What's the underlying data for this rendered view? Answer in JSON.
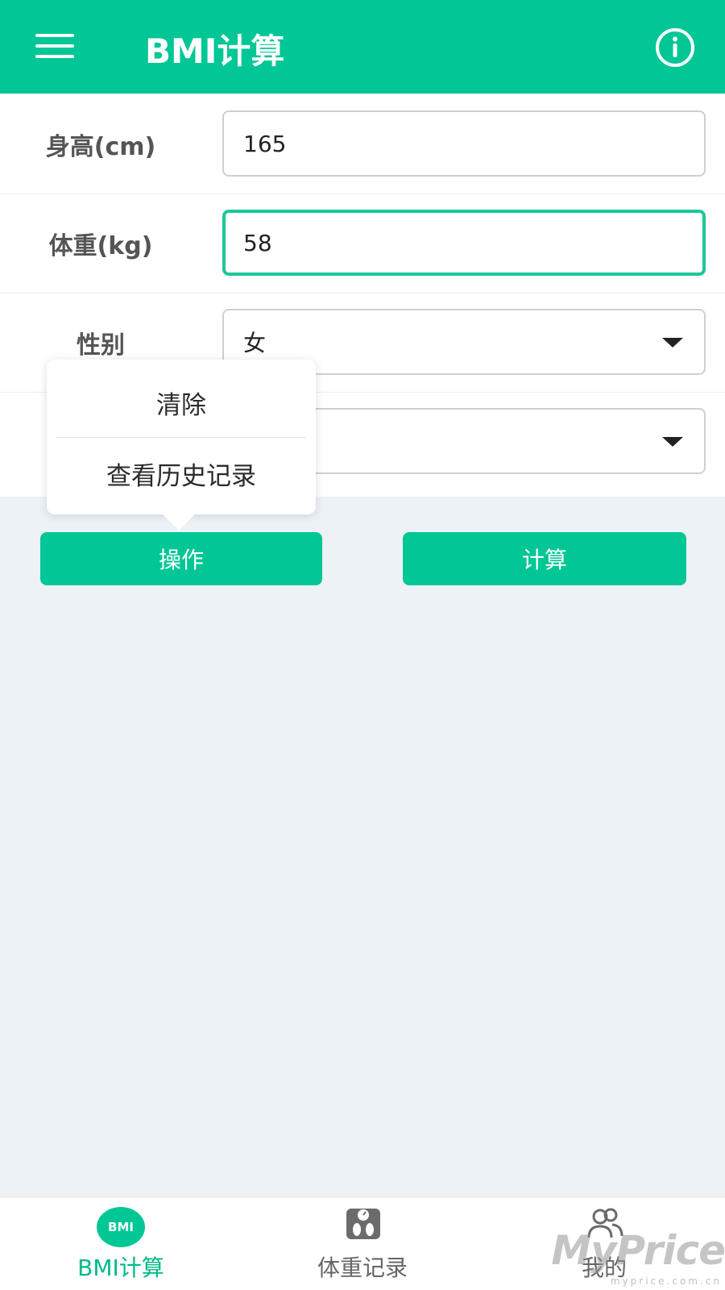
{
  "header": {
    "title": "BMI计算",
    "menu_icon": "hamburger-menu-icon",
    "info_icon": "info-icon"
  },
  "form": {
    "height": {
      "label": "身高(cm)",
      "value": "165"
    },
    "weight": {
      "label": "体重(kg)",
      "value": "58"
    },
    "gender": {
      "label": "性别",
      "value": "女"
    },
    "fourth": {
      "label": "",
      "value": ""
    }
  },
  "popover": {
    "items": [
      {
        "label": "清除"
      },
      {
        "label": "查看历史记录"
      }
    ]
  },
  "buttons": {
    "operations_label": "操作",
    "calculate_label": "计算"
  },
  "bottom_nav": {
    "tabs": [
      {
        "label": "BMI计算",
        "icon": "bmi-badge-icon",
        "badge_text": "BMI",
        "active": true
      },
      {
        "label": "体重记录",
        "icon": "scale-icon",
        "active": false
      },
      {
        "label": "我的",
        "icon": "users-icon",
        "active": false
      }
    ]
  },
  "watermark": {
    "text": "MyPrice",
    "subtext": "myprice.com.cn"
  },
  "colors": {
    "accent": "#00c795",
    "background": "#edf2f6",
    "focus_border": "#19c79a"
  }
}
